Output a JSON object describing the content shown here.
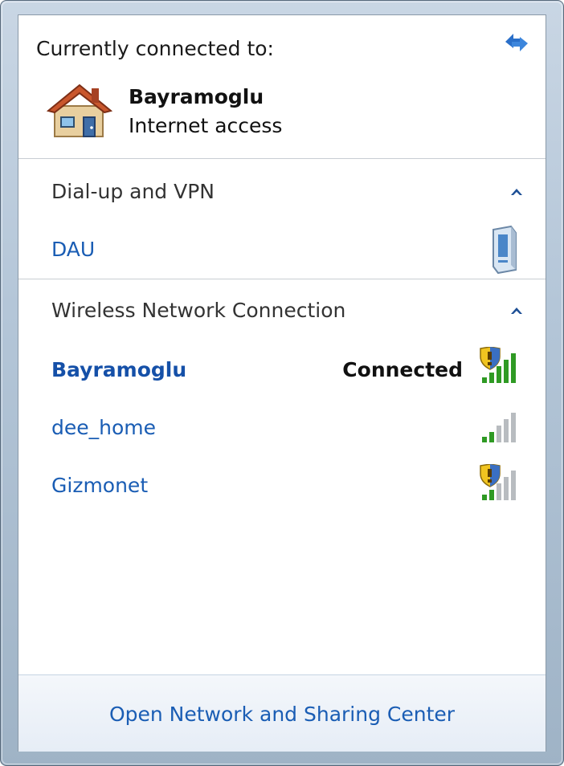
{
  "current": {
    "heading": "Currently connected to:",
    "name": "Bayramoglu",
    "status": "Internet access"
  },
  "dialup": {
    "heading": "Dial-up and VPN",
    "items": [
      {
        "name": "DAU"
      }
    ]
  },
  "wireless": {
    "heading": "Wireless Network Connection",
    "items": [
      {
        "name": "Bayramoglu",
        "status": "Connected",
        "secured": true,
        "signal_bars": 5
      },
      {
        "name": "dee_home",
        "status": "",
        "secured": false,
        "signal_bars": 2
      },
      {
        "name": "Gizmonet",
        "status": "",
        "secured": true,
        "signal_bars": 2
      }
    ]
  },
  "footer": {
    "link": "Open Network and Sharing Center"
  },
  "icons": {
    "refresh": "refresh-icon",
    "network": "house-icon",
    "dialup": "dialup-connection-icon",
    "signal": "wifi-signal-icon",
    "secured": "shield-icon",
    "collapse": "chevron-up-icon"
  },
  "colors": {
    "link": "#1a5db4",
    "signal_active": "#2f9a24",
    "signal_inactive": "#b8bcc0"
  }
}
